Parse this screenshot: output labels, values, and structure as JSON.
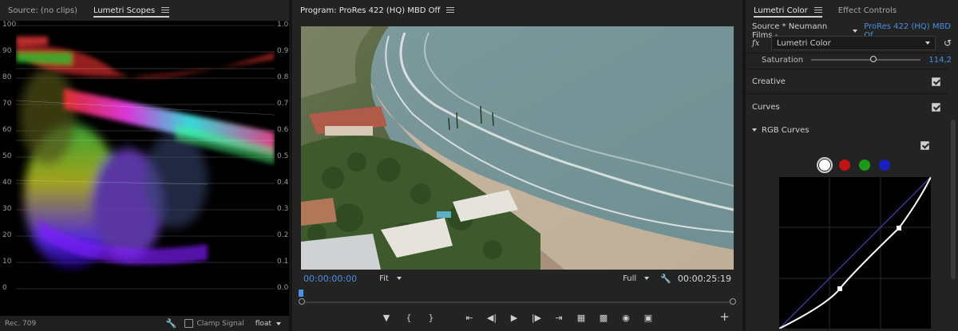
{
  "source_panel": {
    "tabs": [
      {
        "label": "Source: (no clips)",
        "active": false
      },
      {
        "label": "Lumetri Scopes",
        "active": true
      }
    ],
    "scale_left": [
      "100",
      "90",
      "80",
      "70",
      "60",
      "50",
      "40",
      "30",
      "20",
      "10",
      "0"
    ],
    "scale_right": [
      "1.0",
      "0.9",
      "0.8",
      "0.7",
      "0.6",
      "0.5",
      "0.4",
      "0.3",
      "0.2",
      "0.1",
      "0.0"
    ],
    "footer": {
      "standard": "Rec. 709",
      "clamp_label": "Clamp Signal",
      "precision": "float",
      "wrench_icon": "wrench-icon"
    }
  },
  "program_panel": {
    "title": "Program: ProRes 422 (HQ) MBD Off",
    "current_time": "00:00:00:00",
    "zoom": "Fit",
    "resolution": "Full",
    "duration": "00:00:25:19",
    "playhead_fraction": 0.0,
    "transport_icons": [
      "marker-icon",
      "in-point-icon",
      "out-point-icon",
      "go-to-in-icon",
      "step-back-icon",
      "play-icon",
      "step-forward-icon",
      "go-to-out-icon",
      "lift-icon",
      "extract-icon",
      "export-frame-icon",
      "compare-icon"
    ],
    "add_label": "+"
  },
  "lumetri_panel": {
    "tabs": [
      {
        "label": "Lumetri Color",
        "active": true
      },
      {
        "label": "Effect Controls",
        "active": false
      }
    ],
    "source": "Source * Neumann Films - ...",
    "sequence": "ProRes 422 (HQ) MBD Of...",
    "fx_label": "fx",
    "effect": "Lumetri Color",
    "saturation": {
      "label": "Saturation",
      "value": "114,2",
      "fraction": 0.57
    },
    "sections": [
      {
        "label": "Creative",
        "checked": true
      },
      {
        "label": "Curves",
        "checked": true
      }
    ],
    "rgb_curves": {
      "label": "RGB Curves",
      "checked": true
    },
    "channel_colors": [
      "#ffffff",
      "#c01414",
      "#1a9a1a",
      "#1a20c0"
    ],
    "selected_channel": 0
  }
}
